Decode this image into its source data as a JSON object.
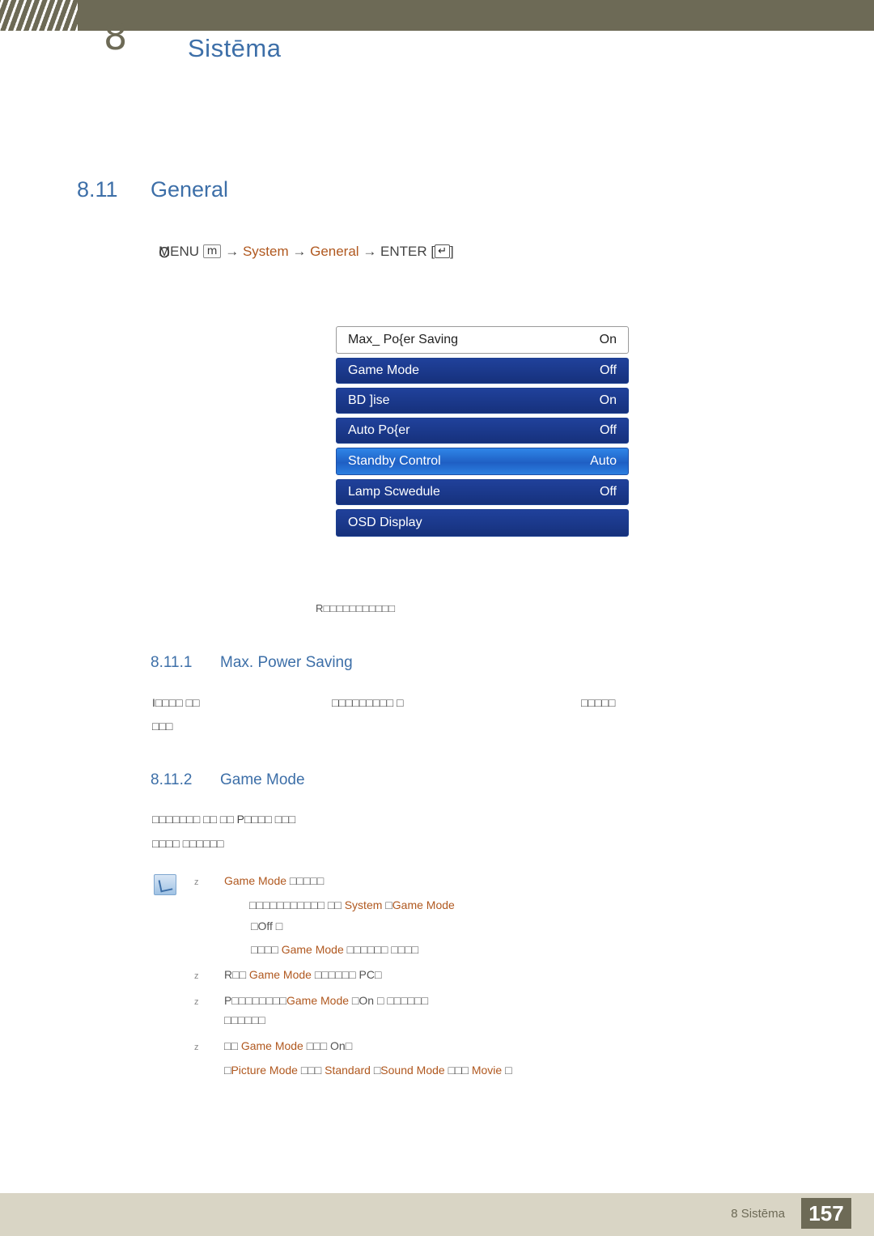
{
  "header": {
    "title": "Sistēma",
    "glyph": "8"
  },
  "section": {
    "number": "8.11",
    "title": "General"
  },
  "path": {
    "bullet": "O",
    "menu_label": "MENU",
    "menu_key": "m",
    "arrow": "→",
    "system": "System",
    "general": "General",
    "enter_label": "ENTER",
    "enter_key": "↵"
  },
  "osd": {
    "rows": [
      {
        "label": "Max_ Po{er Saving",
        "value": "On",
        "style": "first"
      },
      {
        "label": "Game Mode",
        "value": "Off",
        "style": "normal"
      },
      {
        "label": "BD ]ise",
        "value": "On",
        "style": "normal"
      },
      {
        "label": "Auto Po{er",
        "value": "Off",
        "style": "normal"
      },
      {
        "label": "Standby Control",
        "value": "Auto",
        "style": "selected"
      },
      {
        "label": "Lamp Scwedule",
        "value": "Off",
        "style": "normal"
      },
      {
        "label": "OSD Display",
        "value": "",
        "style": "normal"
      }
    ],
    "caption": "R□□□□□□□□□□□"
  },
  "subsections": [
    {
      "number": "8.11.1",
      "title": "Max. Power Saving"
    },
    {
      "number": "8.11.2",
      "title": "Game Mode"
    }
  ],
  "body": {
    "line1a": "I□□□□ □□",
    "line1b": "□□□□□□□□□ □",
    "line1c": "□□□□□",
    "line2": "□□□",
    "line3": "□□□□□□□ □□ □□ P□□□□ □□□",
    "line4": "□□□□ □□□□□□"
  },
  "notes": [
    {
      "marker": "z",
      "segments": [
        {
          "text": "Game Mode",
          "color": "orange"
        },
        {
          "text": "  □□□□□",
          "color": "gray"
        }
      ]
    },
    {
      "marker": "",
      "segments": [
        {
          "text": "□□□□□□□□□□□ □□ ",
          "color": "gray"
        },
        {
          "text": "System",
          "color": "orange"
        },
        {
          "text": "                                                              □",
          "color": "gray"
        },
        {
          "text": "Game Mode",
          "color": "orange"
        }
      ]
    },
    {
      "marker": "",
      "segments": [
        {
          "text": "□Off",
          "color": "gray"
        },
        {
          "text": "   □",
          "color": "gray"
        }
      ]
    },
    {
      "marker": "",
      "segments": [
        {
          "text": "□□□□",
          "color": "gray"
        },
        {
          "text": "      Game Mode",
          "color": "orange"
        },
        {
          "text": "  □□□□□□ □□□□",
          "color": "gray"
        }
      ]
    },
    {
      "marker": "z",
      "segments": [
        {
          "text": "R□□",
          "color": "gray"
        },
        {
          "text": "      Game Mode",
          "color": "orange"
        },
        {
          "text": "   □□□□□□",
          "color": "gray"
        },
        {
          "text": "                                          PC□",
          "color": "gray"
        }
      ]
    },
    {
      "marker": "z",
      "segments": [
        {
          "text": "P□□□□□□□□",
          "color": "gray"
        },
        {
          "text": "Game Mode",
          "color": "orange"
        },
        {
          "text": "                                                  □On",
          "color": "gray"
        },
        {
          "text": "   □ □□□□□□",
          "color": "gray"
        }
      ]
    },
    {
      "marker": "",
      "segments": [
        {
          "text": "□□□□□□",
          "color": "gray"
        }
      ]
    },
    {
      "marker": "z",
      "segments": [
        {
          "text": "□□ ",
          "color": "gray"
        },
        {
          "text": "Game Mode",
          "color": "orange"
        },
        {
          "text": "  □□□",
          "color": "gray"
        },
        {
          "text": "                  On□",
          "color": "gray"
        }
      ]
    },
    {
      "marker": "",
      "segments": [
        {
          "text": "□",
          "color": "gray"
        },
        {
          "text": "Picture Mode",
          "color": "orange"
        },
        {
          "text": "   □□□",
          "color": "gray"
        },
        {
          "text": "            Standard",
          "color": "orange"
        },
        {
          "text": "  □",
          "color": "gray"
        },
        {
          "text": "Sound Mode",
          "color": "orange"
        },
        {
          "text": "      □□□",
          "color": "gray"
        },
        {
          "text": "                   Movie",
          "color": "orange"
        },
        {
          "text": " □",
          "color": "gray"
        }
      ]
    }
  ],
  "footer": {
    "chapter": "8 Sistēma",
    "page": "157"
  }
}
